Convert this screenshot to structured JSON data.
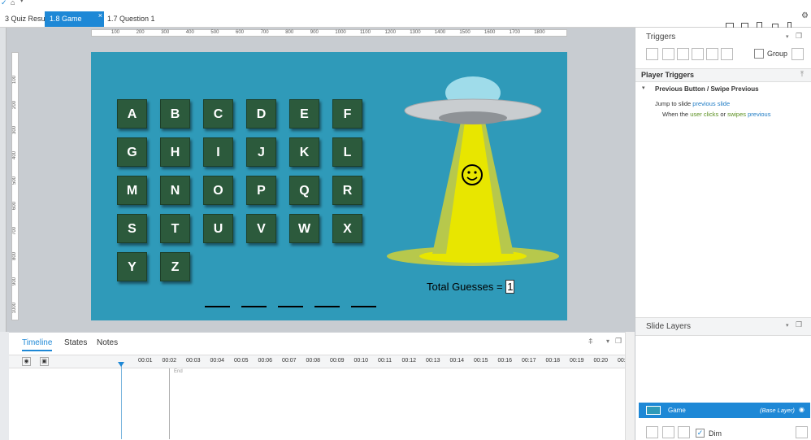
{
  "quick_access": {
    "save_icon": "check-icon",
    "home_icon": "home-icon",
    "dropdown_icon": "chevron-down-icon"
  },
  "tabs": [
    {
      "label": "3 Quiz Results",
      "active": false
    },
    {
      "label": "1.8 Game",
      "active": true
    },
    {
      "label": "1.7 Question 1",
      "active": false
    }
  ],
  "tab_close": "×",
  "ruler": {
    "h_ticks": [
      "100",
      "200",
      "300",
      "400",
      "500",
      "600",
      "700",
      "800",
      "900",
      "1000",
      "1100",
      "1200",
      "1300",
      "1400",
      "1500",
      "1600",
      "1700",
      "1800"
    ],
    "v_ticks": [
      "100",
      "200",
      "300",
      "400",
      "500",
      "600",
      "700",
      "800",
      "900",
      "1000"
    ]
  },
  "slide": {
    "letters": [
      "A",
      "B",
      "C",
      "D",
      "E",
      "F",
      "G",
      "H",
      "I",
      "J",
      "K",
      "L",
      "M",
      "N",
      "O",
      "P",
      "Q",
      "R",
      "S",
      "T",
      "U",
      "V",
      "W",
      "X",
      "Y",
      "Z"
    ],
    "blanks_count": 5,
    "guess_label": "Total Guesses =",
    "guess_value": "1",
    "colors": {
      "background": "#2f9ab9",
      "key": "#2c5a3c",
      "beam": "#e8e600",
      "ufo": "#c9cdd0",
      "dome": "#9fdcea"
    }
  },
  "timeline": {
    "tabs": [
      "Timeline",
      "States",
      "Notes"
    ],
    "seconds": [
      "00:01",
      "00:02",
      "00:03",
      "00:04",
      "00:05",
      "00:06",
      "00:07",
      "00:08",
      "00:09",
      "00:10",
      "00:11",
      "00:12",
      "00:13",
      "00:14",
      "00:15",
      "00:16",
      "00:17",
      "00:18",
      "00:19",
      "00:20",
      "00:"
    ],
    "end_label": "End"
  },
  "triggers": {
    "title": "Triggers",
    "group_label": "Group",
    "section": "Player Triggers",
    "item_title": "Previous Button / Swipe Previous",
    "action_pre": "Jump to slide",
    "action_link": "previous slide",
    "cond_pre": "When the",
    "cond_user": "user clicks",
    "cond_or": "or",
    "cond_swipes": "swipes",
    "cond_prev": "previous"
  },
  "layers": {
    "title": "Slide Layers",
    "items": [
      {
        "name": "Game",
        "tag": "(Base Layer)"
      }
    ],
    "dim_label": "Dim",
    "dim_checked": "✓"
  }
}
